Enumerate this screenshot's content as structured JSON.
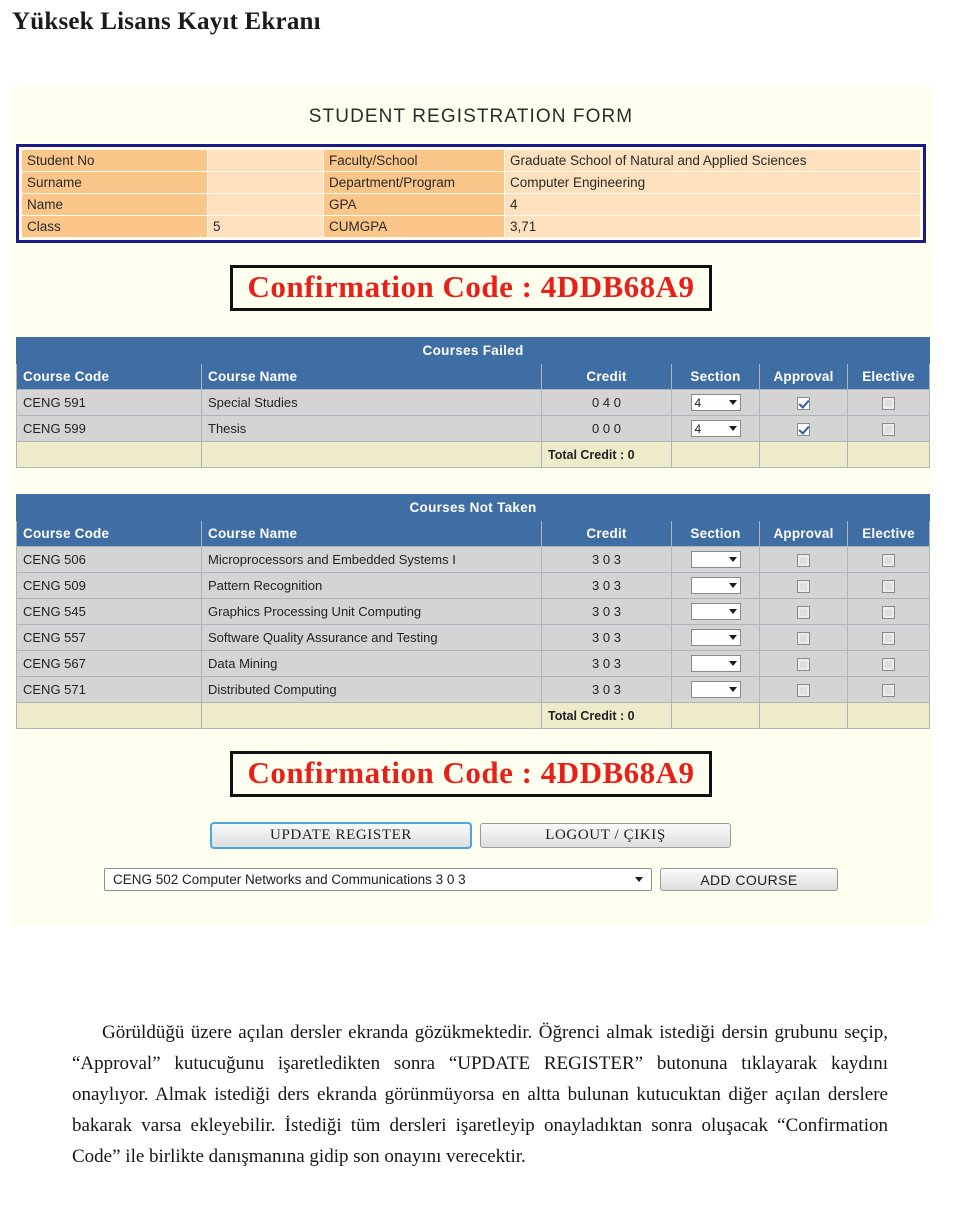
{
  "page": {
    "heading": "Yüksek Lisans Kayıt Ekranı"
  },
  "form": {
    "title": "STUDENT REGISTRATION FORM",
    "student_info": [
      {
        "label": "Student No",
        "value": "",
        "label2": "Faculty/School",
        "value2": "Graduate School of Natural and Applied Sciences"
      },
      {
        "label": "Surname",
        "value": "",
        "label2": "Department/Program",
        "value2": "Computer Engineering"
      },
      {
        "label": "Name",
        "value": "",
        "label2": "GPA",
        "value2": "4"
      },
      {
        "label": "Class",
        "value": "5",
        "label2": "CUMGPA",
        "value2": "3,71"
      }
    ],
    "confirmation_top": "Confirmation Code : 4DDB68A9",
    "confirmation_bottom": "Confirmation Code : 4DDB68A9",
    "columns": {
      "course_code": "Course Code",
      "course_name": "Course Name",
      "credit": "Credit",
      "section": "Section",
      "approval": "Approval",
      "elective": "Elective"
    },
    "courses_failed": {
      "caption": "Courses Failed",
      "rows": [
        {
          "code": "CENG 591",
          "name": "Special Studies",
          "credit": "0 4 0",
          "section": "4",
          "approval": true,
          "elective": false
        },
        {
          "code": "CENG 599",
          "name": "Thesis",
          "credit": "0 0 0",
          "section": "4",
          "approval": true,
          "elective": false
        }
      ],
      "total": "Total Credit : 0"
    },
    "courses_not_taken": {
      "caption": "Courses Not Taken",
      "rows": [
        {
          "code": "CENG 506",
          "name": "Microprocessors and Embedded Systems I",
          "credit": "3 0 3",
          "section": "",
          "approval": false,
          "elective": false
        },
        {
          "code": "CENG 509",
          "name": "Pattern Recognition",
          "credit": "3 0 3",
          "section": "",
          "approval": false,
          "elective": false
        },
        {
          "code": "CENG 545",
          "name": "Graphics Processing Unit Computing",
          "credit": "3 0 3",
          "section": "",
          "approval": false,
          "elective": false
        },
        {
          "code": "CENG 557",
          "name": "Software Quality Assurance and Testing",
          "credit": "3 0 3",
          "section": "",
          "approval": false,
          "elective": false
        },
        {
          "code": "CENG 567",
          "name": "Data Mining",
          "credit": "3 0 3",
          "section": "",
          "approval": false,
          "elective": false
        },
        {
          "code": "CENG 571",
          "name": "Distributed Computing",
          "credit": "3 0 3",
          "section": "",
          "approval": false,
          "elective": false
        }
      ],
      "total": "Total Credit : 0"
    },
    "buttons": {
      "update_register": "UPDATE REGISTER",
      "logout": "LOGOUT / ÇIKIŞ",
      "add_course": "ADD COURSE"
    },
    "add_course_select": {
      "value": "CENG 502 Computer Networks and Communications 3 0 3"
    }
  },
  "body_text": {
    "paragraph": "Görüldüğü üzere açılan dersler ekranda gözükmektedir. Öğrenci almak istediği dersin grubunu seçip, “Approval” kutucuğunu işaretledikten sonra “UPDATE REGISTER” butonuna tıklayarak kaydını onaylıyor. Almak istediği ders ekranda görünmüyorsa en altta bulunan kutucuktan diğer açılan derslere bakarak varsa ekleyebilir. İstediği tüm dersleri işaretleyip onayladıktan sonra oluşacak “Confirmation Code” ile birlikte danışmanına gidip son onayını verecektir."
  },
  "colors": {
    "panel_bg": "#FFFFF0",
    "label_cell": "#FBC68A",
    "value_cell": "#FDE0BD",
    "table_border_navy": "#1A1A8C",
    "header_blue": "#3F6EA5",
    "row_gray": "#D4D4D4",
    "total_row": "#EDEBCA",
    "confirmation_red": "#E8201A",
    "focus_blue": "#4AA8DE"
  }
}
